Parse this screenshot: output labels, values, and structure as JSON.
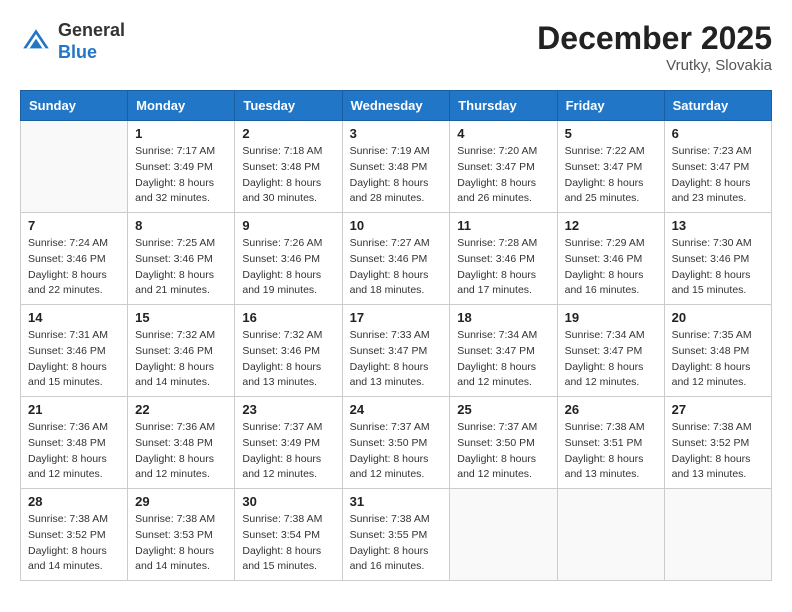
{
  "logo": {
    "general": "General",
    "blue": "Blue"
  },
  "header": {
    "month": "December 2025",
    "location": "Vrutky, Slovakia"
  },
  "days_of_week": [
    "Sunday",
    "Monday",
    "Tuesday",
    "Wednesday",
    "Thursday",
    "Friday",
    "Saturday"
  ],
  "weeks": [
    [
      {
        "day": "",
        "empty": true
      },
      {
        "day": "1",
        "sunrise": "Sunrise: 7:17 AM",
        "sunset": "Sunset: 3:49 PM",
        "daylight": "Daylight: 8 hours and 32 minutes."
      },
      {
        "day": "2",
        "sunrise": "Sunrise: 7:18 AM",
        "sunset": "Sunset: 3:48 PM",
        "daylight": "Daylight: 8 hours and 30 minutes."
      },
      {
        "day": "3",
        "sunrise": "Sunrise: 7:19 AM",
        "sunset": "Sunset: 3:48 PM",
        "daylight": "Daylight: 8 hours and 28 minutes."
      },
      {
        "day": "4",
        "sunrise": "Sunrise: 7:20 AM",
        "sunset": "Sunset: 3:47 PM",
        "daylight": "Daylight: 8 hours and 26 minutes."
      },
      {
        "day": "5",
        "sunrise": "Sunrise: 7:22 AM",
        "sunset": "Sunset: 3:47 PM",
        "daylight": "Daylight: 8 hours and 25 minutes."
      },
      {
        "day": "6",
        "sunrise": "Sunrise: 7:23 AM",
        "sunset": "Sunset: 3:47 PM",
        "daylight": "Daylight: 8 hours and 23 minutes."
      }
    ],
    [
      {
        "day": "7",
        "sunrise": "Sunrise: 7:24 AM",
        "sunset": "Sunset: 3:46 PM",
        "daylight": "Daylight: 8 hours and 22 minutes."
      },
      {
        "day": "8",
        "sunrise": "Sunrise: 7:25 AM",
        "sunset": "Sunset: 3:46 PM",
        "daylight": "Daylight: 8 hours and 21 minutes."
      },
      {
        "day": "9",
        "sunrise": "Sunrise: 7:26 AM",
        "sunset": "Sunset: 3:46 PM",
        "daylight": "Daylight: 8 hours and 19 minutes."
      },
      {
        "day": "10",
        "sunrise": "Sunrise: 7:27 AM",
        "sunset": "Sunset: 3:46 PM",
        "daylight": "Daylight: 8 hours and 18 minutes."
      },
      {
        "day": "11",
        "sunrise": "Sunrise: 7:28 AM",
        "sunset": "Sunset: 3:46 PM",
        "daylight": "Daylight: 8 hours and 17 minutes."
      },
      {
        "day": "12",
        "sunrise": "Sunrise: 7:29 AM",
        "sunset": "Sunset: 3:46 PM",
        "daylight": "Daylight: 8 hours and 16 minutes."
      },
      {
        "day": "13",
        "sunrise": "Sunrise: 7:30 AM",
        "sunset": "Sunset: 3:46 PM",
        "daylight": "Daylight: 8 hours and 15 minutes."
      }
    ],
    [
      {
        "day": "14",
        "sunrise": "Sunrise: 7:31 AM",
        "sunset": "Sunset: 3:46 PM",
        "daylight": "Daylight: 8 hours and 15 minutes."
      },
      {
        "day": "15",
        "sunrise": "Sunrise: 7:32 AM",
        "sunset": "Sunset: 3:46 PM",
        "daylight": "Daylight: 8 hours and 14 minutes."
      },
      {
        "day": "16",
        "sunrise": "Sunrise: 7:32 AM",
        "sunset": "Sunset: 3:46 PM",
        "daylight": "Daylight: 8 hours and 13 minutes."
      },
      {
        "day": "17",
        "sunrise": "Sunrise: 7:33 AM",
        "sunset": "Sunset: 3:47 PM",
        "daylight": "Daylight: 8 hours and 13 minutes."
      },
      {
        "day": "18",
        "sunrise": "Sunrise: 7:34 AM",
        "sunset": "Sunset: 3:47 PM",
        "daylight": "Daylight: 8 hours and 12 minutes."
      },
      {
        "day": "19",
        "sunrise": "Sunrise: 7:34 AM",
        "sunset": "Sunset: 3:47 PM",
        "daylight": "Daylight: 8 hours and 12 minutes."
      },
      {
        "day": "20",
        "sunrise": "Sunrise: 7:35 AM",
        "sunset": "Sunset: 3:48 PM",
        "daylight": "Daylight: 8 hours and 12 minutes."
      }
    ],
    [
      {
        "day": "21",
        "sunrise": "Sunrise: 7:36 AM",
        "sunset": "Sunset: 3:48 PM",
        "daylight": "Daylight: 8 hours and 12 minutes."
      },
      {
        "day": "22",
        "sunrise": "Sunrise: 7:36 AM",
        "sunset": "Sunset: 3:48 PM",
        "daylight": "Daylight: 8 hours and 12 minutes."
      },
      {
        "day": "23",
        "sunrise": "Sunrise: 7:37 AM",
        "sunset": "Sunset: 3:49 PM",
        "daylight": "Daylight: 8 hours and 12 minutes."
      },
      {
        "day": "24",
        "sunrise": "Sunrise: 7:37 AM",
        "sunset": "Sunset: 3:50 PM",
        "daylight": "Daylight: 8 hours and 12 minutes."
      },
      {
        "day": "25",
        "sunrise": "Sunrise: 7:37 AM",
        "sunset": "Sunset: 3:50 PM",
        "daylight": "Daylight: 8 hours and 12 minutes."
      },
      {
        "day": "26",
        "sunrise": "Sunrise: 7:38 AM",
        "sunset": "Sunset: 3:51 PM",
        "daylight": "Daylight: 8 hours and 13 minutes."
      },
      {
        "day": "27",
        "sunrise": "Sunrise: 7:38 AM",
        "sunset": "Sunset: 3:52 PM",
        "daylight": "Daylight: 8 hours and 13 minutes."
      }
    ],
    [
      {
        "day": "28",
        "sunrise": "Sunrise: 7:38 AM",
        "sunset": "Sunset: 3:52 PM",
        "daylight": "Daylight: 8 hours and 14 minutes."
      },
      {
        "day": "29",
        "sunrise": "Sunrise: 7:38 AM",
        "sunset": "Sunset: 3:53 PM",
        "daylight": "Daylight: 8 hours and 14 minutes."
      },
      {
        "day": "30",
        "sunrise": "Sunrise: 7:38 AM",
        "sunset": "Sunset: 3:54 PM",
        "daylight": "Daylight: 8 hours and 15 minutes."
      },
      {
        "day": "31",
        "sunrise": "Sunrise: 7:38 AM",
        "sunset": "Sunset: 3:55 PM",
        "daylight": "Daylight: 8 hours and 16 minutes."
      },
      {
        "day": "",
        "empty": true
      },
      {
        "day": "",
        "empty": true
      },
      {
        "day": "",
        "empty": true
      }
    ]
  ]
}
